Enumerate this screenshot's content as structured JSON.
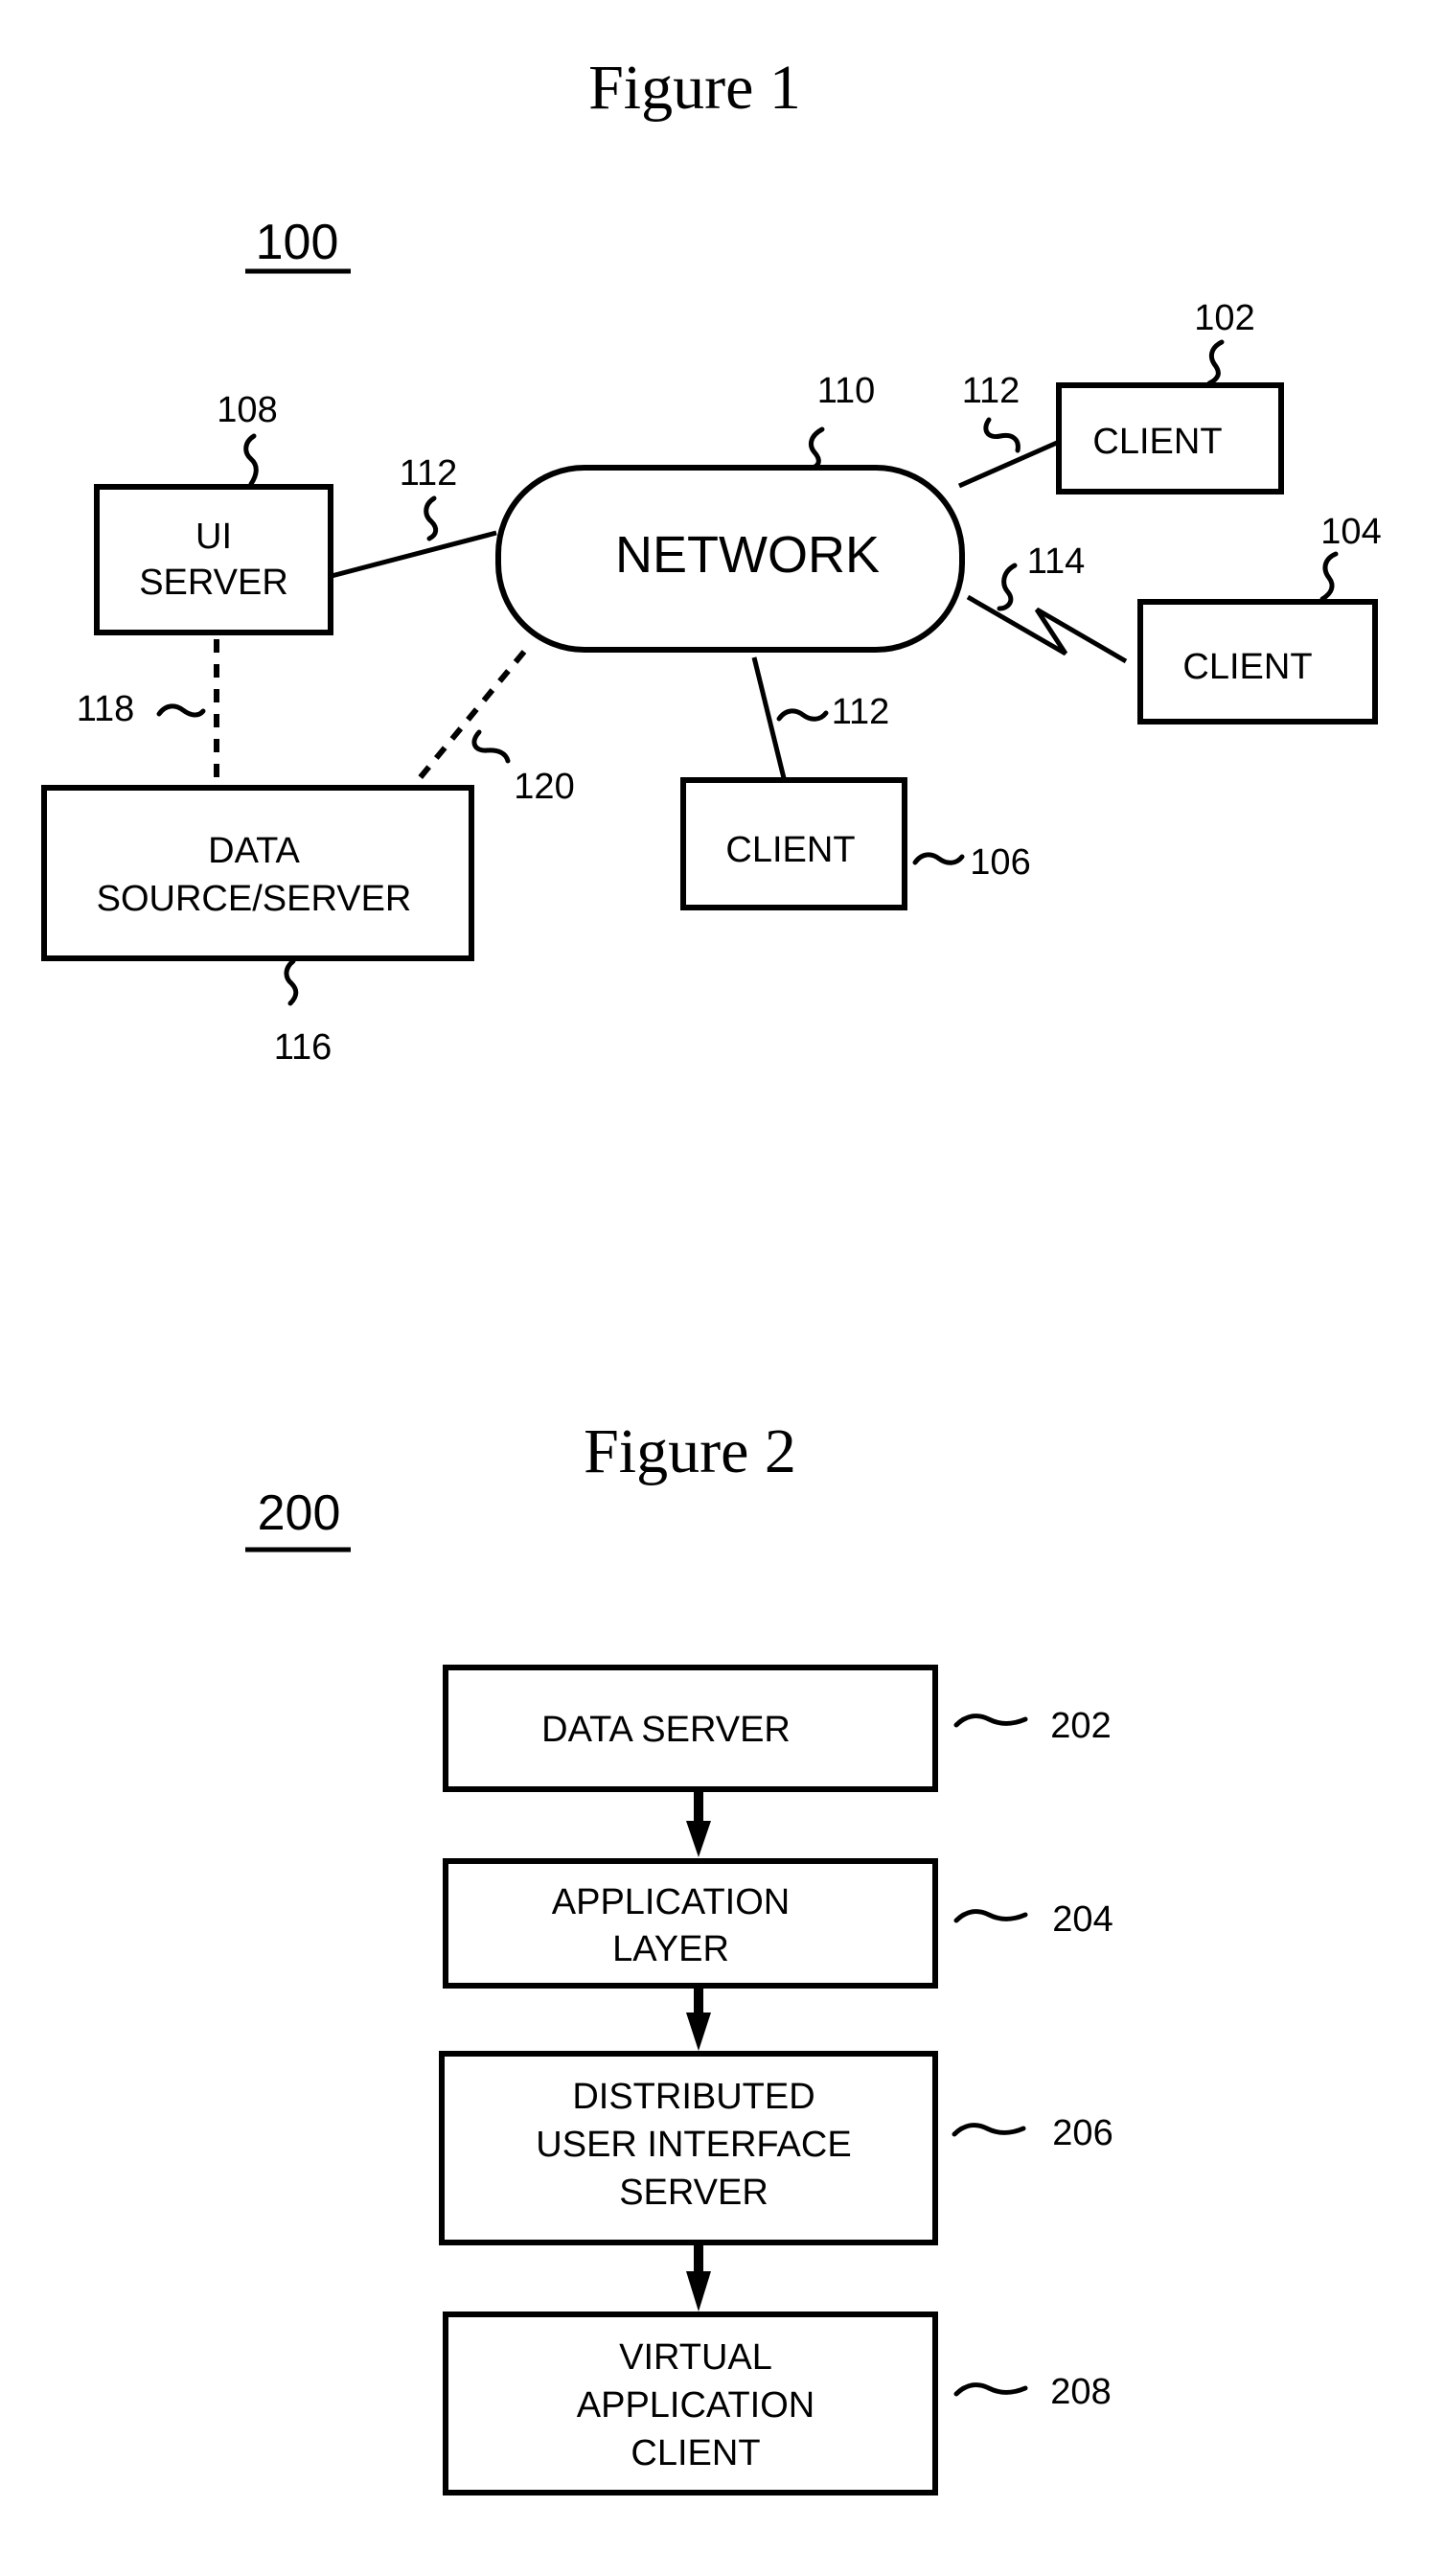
{
  "figure1": {
    "title": "Figure 1",
    "number": "100",
    "network": {
      "label": "NETWORK",
      "ref": "110"
    },
    "ui_server": {
      "lines": [
        "UI",
        "SERVER"
      ],
      "ref": "108"
    },
    "data_source": {
      "lines": [
        "DATA",
        "SOURCE/SERVER"
      ],
      "ref": "116"
    },
    "clients": [
      {
        "label": "CLIENT",
        "ref": "102"
      },
      {
        "label": "CLIENT",
        "ref": "104"
      },
      {
        "label": "CLIENT",
        "ref": "106"
      }
    ],
    "connections": {
      "wired_ref": "112",
      "wireless_ref": "114",
      "ui_to_data_ref": "118",
      "network_to_data_ref": "120"
    }
  },
  "figure2": {
    "title": "Figure 2",
    "number": "200",
    "blocks": [
      {
        "lines": [
          "DATA SERVER"
        ],
        "ref": "202"
      },
      {
        "lines": [
          "APPLICATION",
          "LAYER"
        ],
        "ref": "204"
      },
      {
        "lines": [
          "DISTRIBUTED",
          "USER INTERFACE",
          "SERVER"
        ],
        "ref": "206"
      },
      {
        "lines": [
          "VIRTUAL",
          "APPLICATION",
          "CLIENT"
        ],
        "ref": "208"
      }
    ]
  }
}
